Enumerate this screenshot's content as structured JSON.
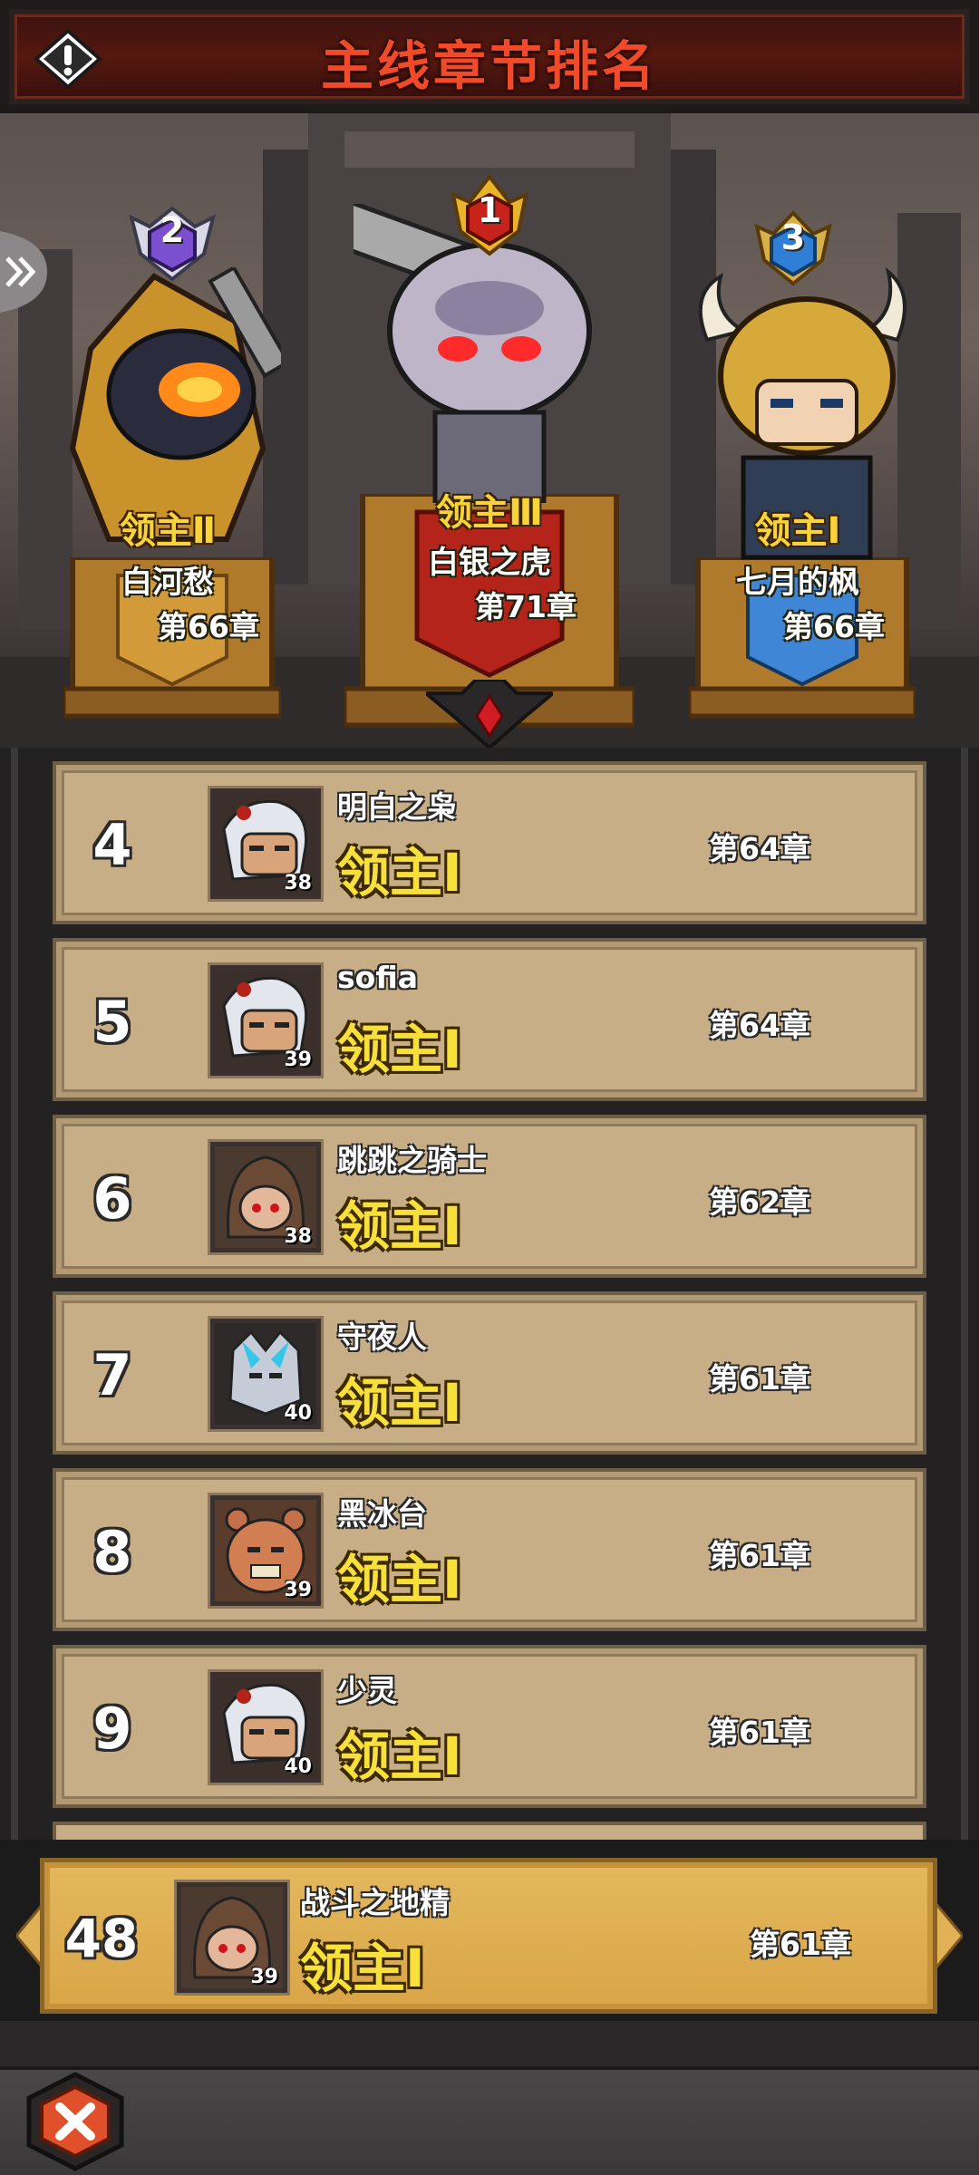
{
  "header": {
    "title": "主线章节排名",
    "info_icon": "exclamation-icon"
  },
  "podium": [
    {
      "rank": "2",
      "title": "领主Ⅱ",
      "name": "白河愁",
      "chapter": "第66章",
      "badge_color": "#7b4fd0"
    },
    {
      "rank": "1",
      "title": "领主Ⅲ",
      "name": "白银之虎",
      "chapter": "第71章",
      "badge_color": "#c8231a"
    },
    {
      "rank": "3",
      "title": "领主Ⅰ",
      "name": "七月的枫",
      "chapter": "第66章",
      "badge_color": "#2f7fd6"
    }
  ],
  "rankings": [
    {
      "rank": "4",
      "name": "明白之枭",
      "title": "领主Ⅰ",
      "level": "38",
      "chapter": "第64章",
      "avatar": "white-hair-elder"
    },
    {
      "rank": "5",
      "name": "sofia",
      "title": "领主Ⅰ",
      "level": "39",
      "chapter": "第64章",
      "avatar": "white-hair-elder"
    },
    {
      "rank": "6",
      "name": "跳跳之骑士",
      "title": "领主Ⅰ",
      "level": "38",
      "chapter": "第62章",
      "avatar": "hooded-rogue"
    },
    {
      "rank": "7",
      "name": "守夜人",
      "title": "领主Ⅰ",
      "level": "40",
      "chapter": "第61章",
      "avatar": "ice-wolf"
    },
    {
      "rank": "8",
      "name": "黑冰台",
      "title": "领主Ⅰ",
      "level": "39",
      "chapter": "第61章",
      "avatar": "bear-brute"
    },
    {
      "rank": "9",
      "name": "少灵",
      "title": "领主Ⅰ",
      "level": "40",
      "chapter": "第61章",
      "avatar": "white-hair-elder"
    }
  ],
  "self": {
    "rank": "48",
    "name": "战斗之地精",
    "title": "领主Ⅰ",
    "level": "39",
    "chapter": "第61章",
    "avatar": "hooded-rogue"
  },
  "bottom": {
    "close_icon": "close-x-icon"
  }
}
